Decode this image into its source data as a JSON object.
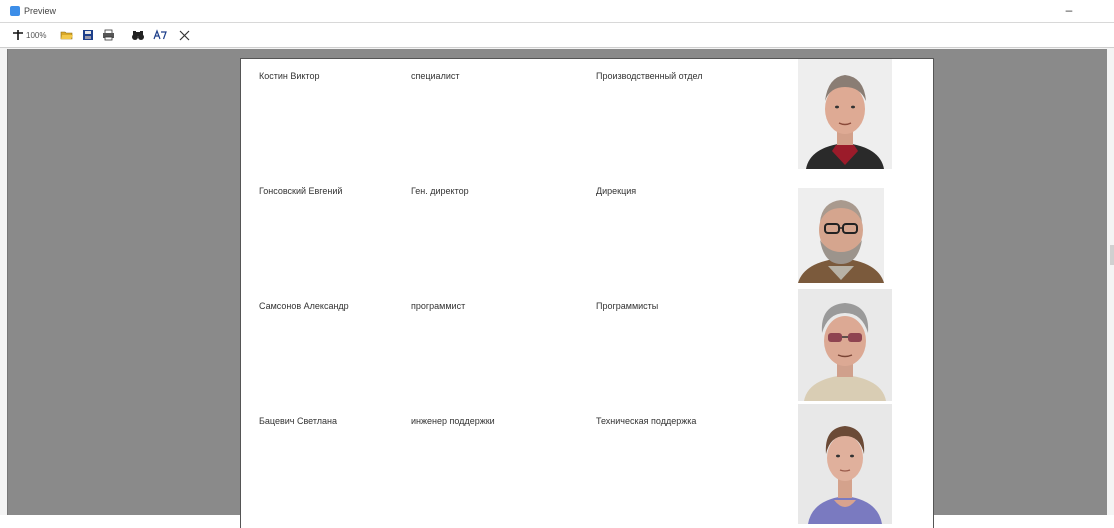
{
  "window": {
    "title": "Preview",
    "minimize_label": "–"
  },
  "toolbar": {
    "zoom": "100%"
  },
  "employees": [
    {
      "name": "Костин Виктор",
      "position": "специалист",
      "department": "Производственный отдел",
      "photo": "man-gray-hair-red-shirt"
    },
    {
      "name": "Гонсовский Евгений",
      "position": "Ген. директор",
      "department": "Дирекция",
      "photo": "man-bald-glasses-beard"
    },
    {
      "name": "Самсонов Александр",
      "position": "программист",
      "department": "Программисты",
      "photo": "man-gray-hair-glasses"
    },
    {
      "name": "Бацевич Светлана",
      "position": "инженер поддержки",
      "department": "Техническая поддержка",
      "photo": "woman-hair-pulled-back"
    }
  ]
}
